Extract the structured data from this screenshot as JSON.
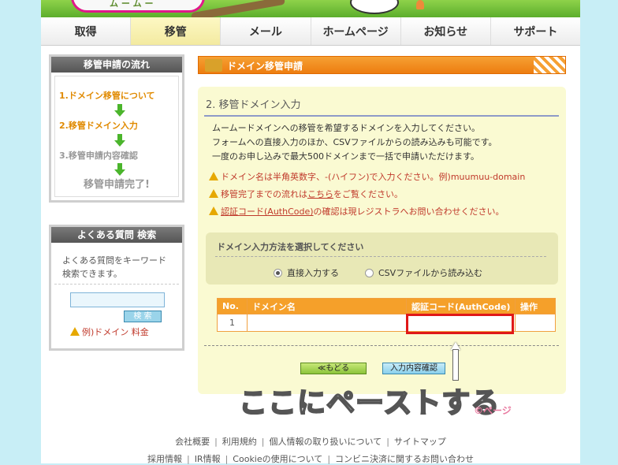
{
  "nav": {
    "tabs": [
      {
        "label": "取得",
        "active": false
      },
      {
        "label": "移管",
        "active": true
      },
      {
        "label": "メール",
        "active": false
      },
      {
        "label": "ホームページ",
        "active": false
      },
      {
        "label": "お知らせ",
        "active": false
      },
      {
        "label": "サポート",
        "active": false
      }
    ]
  },
  "sidebar": {
    "flow_title": "移管申請の流れ",
    "steps": [
      {
        "label": "1.ドメイン移管について",
        "state": "done"
      },
      {
        "label": "2.移管ドメイン入力",
        "state": "done"
      },
      {
        "label": "3.移管申請内容確認",
        "state": "todo"
      }
    ],
    "final": "移管申請完了!",
    "faq_title": "よくある質問 検索",
    "faq_desc": "よくある質問をキーワード検索できます。",
    "search_value": "",
    "search_button": "検 索",
    "example": "例)ドメイン 料金"
  },
  "main": {
    "title": "ドメイン移管申請",
    "step_heading": "2. 移管ドメイン入力",
    "intro": [
      "ムームードメインへの移管を希望するドメインを入力してください。",
      "フォームへの直接入力のほか、CSVファイルからの読み込みも可能です。",
      "一度のお申し込みで最大500ドメインまで一括で申請いただけます。"
    ],
    "warnings": [
      {
        "before": "ドメイン名は半角英数字、-(ハイフン)で入力ください。例)muumuu-domain",
        "link": "",
        "after": ""
      },
      {
        "before": "移管完了までの流れは",
        "link": "こちら",
        "after": "をご覧ください。"
      },
      {
        "before": "",
        "link": "認証コード(AuthCode)",
        "after": "の確認は現レジストラへお問い合わせください。"
      }
    ],
    "method_title": "ドメイン入力方法を選択してください",
    "options": [
      {
        "label": "直接入力する",
        "selected": true
      },
      {
        "label": "CSVファイルから読み込む",
        "selected": false
      }
    ],
    "table": {
      "headers": [
        "No.",
        "ドメイン名",
        "認証コード(AuthCode)",
        "操作"
      ],
      "rows": [
        [
          "1",
          "",
          "",
          ""
        ]
      ]
    },
    "back_button": "≪もどる",
    "next_button": "入力内容確認",
    "annotation": "ここにペーストする",
    "watermark": "©ぺージ"
  },
  "footer": {
    "row1": [
      "会社概要",
      "利用規約",
      "個人情報の取り扱いについて",
      "サイトマップ"
    ],
    "row2": [
      "採用情報",
      "IR情報",
      "Cookieの使用について",
      "コンビニ決済に関するお問い合わせ"
    ]
  }
}
